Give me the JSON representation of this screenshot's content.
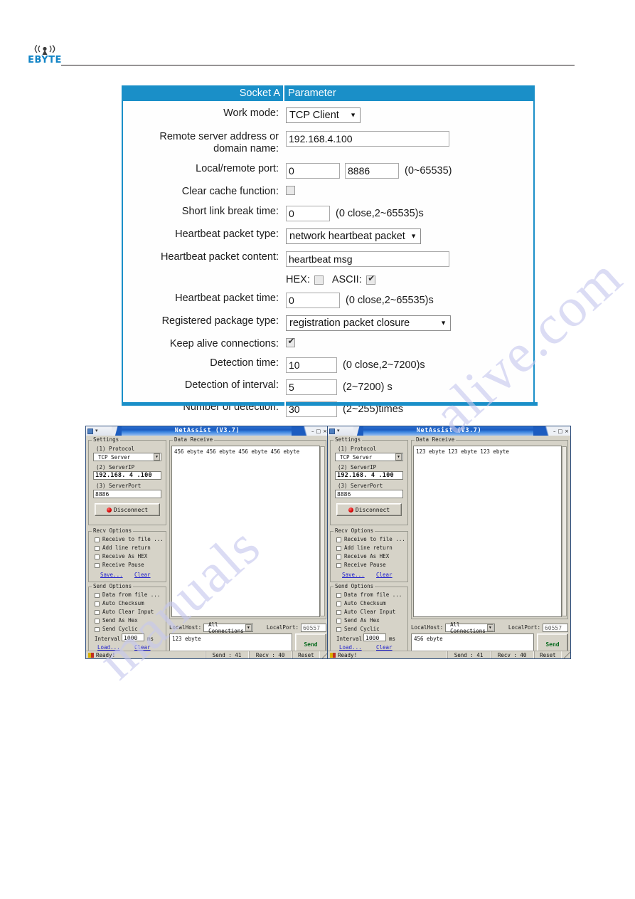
{
  "branding": {
    "logo_text": "EBYTE",
    "logo_icon": "antenna-signal-icon"
  },
  "watermark": {
    "line1": "alive.com",
    "line2": "manuals"
  },
  "socket_panel": {
    "header": {
      "left": "Socket A",
      "right": "Parameter"
    },
    "rows": {
      "work_mode": {
        "label": "Work mode:",
        "value": "TCP Client"
      },
      "remote_server": {
        "label": "Remote server address or domain name:",
        "value": "192.168.4.100"
      },
      "port": {
        "label": "Local/remote port:",
        "local": "0",
        "remote": "8886",
        "hint": "(0~65535)"
      },
      "clear_cache": {
        "label": "Clear cache function:",
        "checked": false
      },
      "short_link": {
        "label": "Short link break time:",
        "value": "0",
        "hint": "(0 close,2~65535)s"
      },
      "hb_type": {
        "label": "Heartbeat packet type:",
        "value": "network heartbeat packet"
      },
      "hb_content": {
        "label": "Heartbeat packet content:",
        "value": "heartbeat msg"
      },
      "encoding": {
        "hex_label": "HEX:",
        "hex_checked": false,
        "ascii_label": "ASCII:",
        "ascii_checked": true
      },
      "hb_time": {
        "label": "Heartbeat packet time:",
        "value": "0",
        "hint": "(0 close,2~65535)s"
      },
      "reg_type": {
        "label": "Registered package type:",
        "value": "registration packet closure"
      },
      "keep_alive": {
        "label": "Keep alive connections:",
        "checked": true
      },
      "detect_time": {
        "label": "Detection time:",
        "value": "10",
        "hint": "(0 close,2~7200)s"
      },
      "detect_interval": {
        "label": "Detection of interval:",
        "value": "5",
        "hint": "(2~7200) s"
      },
      "detect_number": {
        "label": "Number of detection:",
        "value": "30",
        "hint": "(2~255)times"
      }
    }
  },
  "netassist": {
    "title": "NetAssist (V3.7)",
    "window_buttons": {
      "minimize": "–",
      "maximize": "□",
      "close": "×"
    },
    "settings": {
      "group_title": "Settings",
      "protocol_label": "(1) Protocol",
      "protocol_value": "TCP Server",
      "serverip_label": "(2) ServerIP",
      "serverip_value": "192.168. 4 .100",
      "serverport_label": "(3) ServerPort",
      "serverport_value": "8886",
      "connect_button": "Disconnect"
    },
    "recv_options": {
      "group_title": "Recv Options",
      "items": [
        {
          "label": "Receive to file ...",
          "checked": false
        },
        {
          "label": "Add line return",
          "checked": false
        },
        {
          "label": "Receive As HEX",
          "checked": false
        },
        {
          "label": "Receive Pause",
          "checked": false
        }
      ],
      "save_link": "Save...",
      "clear_link": "Clear"
    },
    "send_options": {
      "group_title": "Send Options",
      "items": [
        {
          "label": "Data from file ...",
          "checked": false
        },
        {
          "label": "Auto Checksum",
          "checked": false
        },
        {
          "label": "Auto Clear Input",
          "checked": false
        },
        {
          "label": "Send As Hex",
          "checked": false
        },
        {
          "label": "Send Cyclic",
          "checked": false
        }
      ],
      "interval_label": "Interval",
      "interval_value": "1000",
      "interval_unit": "ms",
      "load_link": "Load...",
      "clear_link": "Clear"
    },
    "data_receive": {
      "group_title": "Data Receive"
    },
    "host_row": {
      "localhost_label": "LocalHost:",
      "localhost_value": "All Connections",
      "localport_label": "LocalPort:",
      "localport_value": "60557"
    },
    "send_button": "Send",
    "status": {
      "ready": "Ready!",
      "send_count": "Send : 41",
      "recv_count": "Recv : 40",
      "reset": "Reset"
    },
    "left_window": {
      "received_text": "456 ebyte 456 ebyte 456 ebyte 456 ebyte",
      "send_text": "123 ebyte"
    },
    "right_window": {
      "received_text": "123 ebyte 123 ebyte 123 ebyte",
      "send_text": "456 ebyte"
    }
  }
}
